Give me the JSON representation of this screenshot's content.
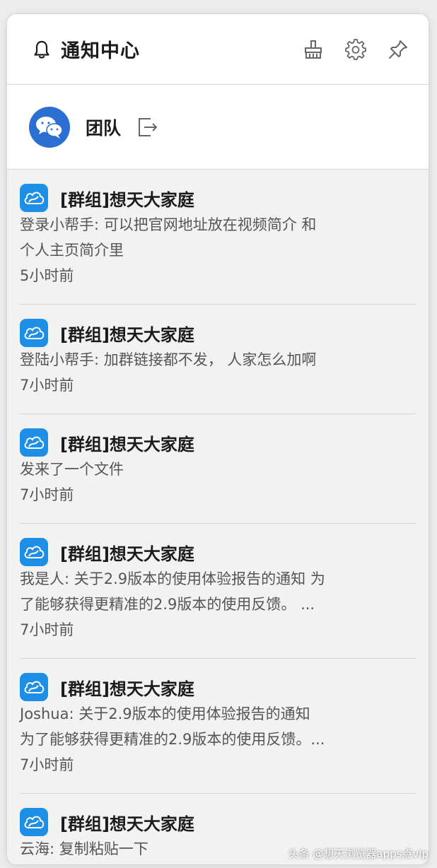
{
  "header": {
    "title": "通知中心",
    "tools": [
      "clear-all-icon",
      "settings-icon",
      "pin-icon"
    ]
  },
  "team": {
    "name": "团队"
  },
  "notifications": [
    {
      "title": "[群组]想天大家庭",
      "lines": [
        "登录小帮手: 可以把官网地址放在视频简介 和",
        "个人主页简介里"
      ],
      "time": "5小时前"
    },
    {
      "title": "[群组]想天大家庭",
      "lines": [
        "登陆小帮手: 加群链接都不发， 人家怎么加啊"
      ],
      "time": "7小时前"
    },
    {
      "title": "[群组]想天大家庭",
      "lines": [
        "发来了一个文件"
      ],
      "time": "7小时前"
    },
    {
      "title": "[群组]想天大家庭",
      "lines": [
        "我是人: 关于2.9版本的使用体验报告的通知 为",
        "了能够获得更精准的2.9版本的使用反馈。 ..."
      ],
      "time": "7小时前"
    },
    {
      "title": "[群组]想天大家庭",
      "lines": [
        "Joshua: 关于2.9版本的使用体验报告的通知",
        "为了能够获得更精准的2.9版本的使用反馈。..."
      ],
      "time": "7小时前"
    },
    {
      "title": "[群组]想天大家庭",
      "lines": [
        "云海: 复制粘贴一下"
      ],
      "time": ""
    }
  ],
  "watermark": "头条 @想天浏览器apps点vip",
  "colors": {
    "accent_blue": "#1e8fe6",
    "team_avatar": "#2c6fd2",
    "panel_bg": "#f2f2f2"
  }
}
